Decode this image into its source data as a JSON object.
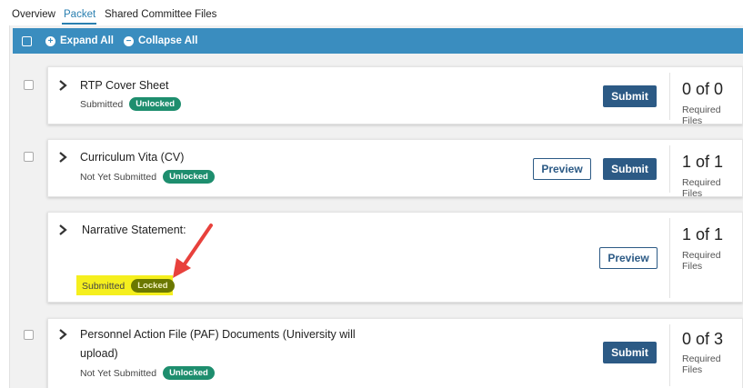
{
  "tabs": [
    {
      "label": "Overview"
    },
    {
      "label": "Packet"
    },
    {
      "label": "Shared Committee Files"
    }
  ],
  "toolbar": {
    "expand_all": "Expand All",
    "collapse_all": "Collapse All"
  },
  "items": [
    {
      "title": "RTP Cover Sheet",
      "status": "Submitted",
      "badge": "Unlocked",
      "submit": "Submit",
      "count": "0 of 0",
      "count_label": "Required Files"
    },
    {
      "title": "Curriculum Vita (CV)",
      "status": "Not Yet Submitted",
      "badge": "Unlocked",
      "preview": "Preview",
      "submit": "Submit",
      "count": "1 of 1",
      "count_label": "Required Files"
    },
    {
      "title": "Narrative Statement:",
      "status": "Submitted",
      "badge": "Locked",
      "preview": "Preview",
      "count": "1 of 1",
      "count_label": "Required Files"
    },
    {
      "title_line1": "Personnel Action File (PAF) Documents (University will",
      "title_line2": "upload)",
      "status": "Not Yet Submitted",
      "badge": "Unlocked",
      "submit": "Submit",
      "count": "0 of 3",
      "count_label": "Required Files"
    }
  ],
  "colors": {
    "toolbar": "#3a8dbf",
    "primary_button": "#2c5a85",
    "unlocked_badge": "#1e8e6e",
    "locked_badge": "#6b7800",
    "highlight": "#f5ef1e",
    "annotation_arrow": "#e8413c"
  },
  "icons": {
    "expand": "plus-circle-icon",
    "collapse": "minus-circle-icon",
    "row_toggle": "chevron-right-icon"
  }
}
